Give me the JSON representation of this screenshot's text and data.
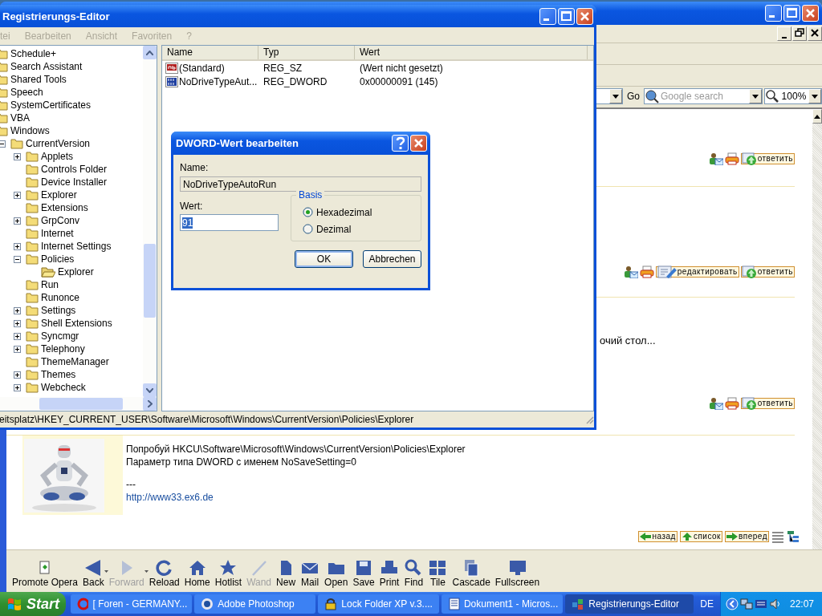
{
  "browser": {
    "address_bar": {
      "go_button": "Go",
      "search": {
        "placeholder": "Google search"
      },
      "zoom": "100%"
    },
    "posts": [
      {
        "actions": [
          {
            "kind": "profile"
          },
          {
            "kind": "print"
          },
          {
            "kind": "reply",
            "label": "ответить"
          }
        ]
      },
      {
        "actions": [
          {
            "kind": "profile"
          },
          {
            "kind": "print"
          },
          {
            "kind": "edit",
            "label": "редактировать"
          },
          {
            "kind": "reply",
            "label": "ответить"
          }
        ]
      },
      {
        "text": "очий стол...",
        "actions": [
          {
            "kind": "profile"
          },
          {
            "kind": "print"
          },
          {
            "kind": "reply",
            "label": "ответить"
          }
        ]
      },
      {
        "avatar": {
          "kind": "picture"
        },
        "lines": [
          "Попробуй HKCU\\Software\\Microsoft\\Windows\\CurrentVersion\\Policies\\Explorer",
          "Параметр типа DWORD с именем NoSaveSetting=0",
          "---"
        ],
        "link": "http://www33.ex6.de"
      }
    ],
    "pagination": [
      {
        "kind": "back",
        "label": "назад"
      },
      {
        "kind": "list",
        "label": "список"
      },
      {
        "kind": "forward",
        "label": "вперед"
      }
    ],
    "toolbar": [
      {
        "kind": "promote",
        "label": "Promote Opera",
        "disabled": false
      },
      {
        "kind": "back",
        "label": "Back",
        "disabled": false
      },
      {
        "kind": "forward",
        "label": "Forward",
        "disabled": true
      },
      {
        "kind": "reload",
        "label": "Reload",
        "disabled": false
      },
      {
        "kind": "home",
        "label": "Home",
        "disabled": false
      },
      {
        "kind": "hotlist",
        "label": "Hotlist",
        "disabled": false
      },
      {
        "kind": "wand",
        "label": "Wand",
        "disabled": true
      },
      {
        "kind": "new",
        "label": "New",
        "disabled": false
      },
      {
        "kind": "mail",
        "label": "Mail",
        "disabled": false
      },
      {
        "kind": "open",
        "label": "Open",
        "disabled": false
      },
      {
        "kind": "save",
        "label": "Save",
        "disabled": false
      },
      {
        "kind": "print",
        "label": "Print",
        "disabled": false
      },
      {
        "kind": "find",
        "label": "Find",
        "disabled": false
      },
      {
        "kind": "tile",
        "label": "Tile",
        "disabled": false
      },
      {
        "kind": "cascade",
        "label": "Cascade",
        "disabled": false
      },
      {
        "kind": "fullscreen",
        "label": "Fullscreen",
        "disabled": false
      }
    ]
  },
  "regedit": {
    "title": "Registrierungs-Editor",
    "menu": [
      {
        "label": "tei",
        "disabled": true
      },
      {
        "label": "Bearbeiten",
        "disabled": true
      },
      {
        "label": "Ansicht",
        "disabled": true
      },
      {
        "label": "Favoriten",
        "disabled": true
      },
      {
        "label": "?",
        "disabled": true
      }
    ],
    "tree": [
      {
        "label": "Schedule+",
        "selected": false
      },
      {
        "label": "Search Assistant",
        "selected": false
      },
      {
        "label": "Shared Tools",
        "selected": false
      },
      {
        "label": "Speech",
        "selected": false
      },
      {
        "label": "SystemCertificates",
        "selected": false
      },
      {
        "label": "VBA",
        "selected": false
      },
      {
        "label": "Windows",
        "selected": false,
        "children": [
          {
            "label": "CurrentVersion",
            "selected": false,
            "expanded": true,
            "children": [
              {
                "label": "Applets",
                "selected": false,
                "expanded": false
              },
              {
                "label": "Controls Folder",
                "selected": false
              },
              {
                "label": "Device Installer",
                "selected": false
              },
              {
                "label": "Explorer",
                "selected": false,
                "expanded": false
              },
              {
                "label": "Extensions",
                "selected": false
              },
              {
                "label": "GrpConv",
                "selected": false,
                "expanded": false
              },
              {
                "label": "Internet",
                "selected": false
              },
              {
                "label": "Internet Settings",
                "selected": false,
                "expanded": false
              },
              {
                "label": "Policies",
                "selected": false,
                "expanded": true,
                "children": [
                  {
                    "label": "Explorer",
                    "selected": true
                  }
                ]
              },
              {
                "label": "Run",
                "selected": false
              },
              {
                "label": "Runonce",
                "selected": false
              },
              {
                "label": "Settings",
                "selected": false,
                "expanded": false
              },
              {
                "label": "Shell Extensions",
                "selected": false,
                "expanded": false
              },
              {
                "label": "Syncmgr",
                "selected": false,
                "expanded": false
              },
              {
                "label": "Telephony",
                "selected": false,
                "expanded": false
              },
              {
                "label": "ThemeManager",
                "selected": false
              },
              {
                "label": "Themes",
                "selected": false,
                "expanded": false
              },
              {
                "label": "Webcheck",
                "selected": false,
                "expanded": false
              }
            ]
          }
        ]
      }
    ],
    "list": {
      "columns": [
        "Name",
        "Typ",
        "Wert"
      ],
      "rows": [
        {
          "kind": "string",
          "name": "(Standard)",
          "type": "REG_SZ",
          "value": "(Wert nicht gesetzt)"
        },
        {
          "kind": "binary",
          "name": "NoDriveTypeAut...",
          "type": "REG_DWORD",
          "value": "0x00000091 (145)"
        }
      ]
    },
    "status_bar": "eitsplatz\\HKEY_CURRENT_USER\\Software\\Microsoft\\Windows\\CurrentVersion\\Policies\\Explorer"
  },
  "dialog": {
    "title": "DWORD-Wert bearbeiten",
    "name_label": "Name:",
    "name_value": "NoDriveTypeAutoRun",
    "value_label": "Wert:",
    "value": "91",
    "base_label": "Basis",
    "bases": [
      {
        "label": "Hexadezimal",
        "selected": true
      },
      {
        "label": "Dezimal",
        "selected": false
      }
    ],
    "buttons": [
      {
        "label": "OK",
        "default": true
      },
      {
        "label": "Abbrechen",
        "default": false
      }
    ]
  },
  "taskbar": {
    "start": "Start",
    "tasks": [
      {
        "kind": "browser",
        "label": "[ Foren - GERMANY...",
        "selected": false
      },
      {
        "kind": "eye",
        "label": "Adobe Photoshop",
        "selected": false
      },
      {
        "kind": "lock",
        "label": "Lock Folder XP v.3....",
        "selected": false
      },
      {
        "kind": "document",
        "label": "Dokument1 - Micros...",
        "selected": false
      },
      {
        "kind": "registry",
        "label": "Registrierungs-Editor",
        "selected": true
      }
    ],
    "language": "DE",
    "clock": "22:07"
  }
}
